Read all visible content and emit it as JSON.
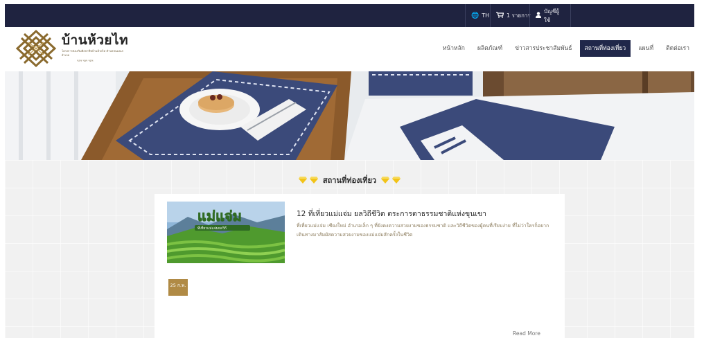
{
  "topbar": {
    "language": "TH",
    "cart": "1 รายการ",
    "account": "บัญชีผู้ใช้"
  },
  "brand": {
    "name": "บ้านห้วยไท",
    "tagline": "โครงการส่งเสริมศิลปาชีพบ้านห้วยไท ตำบลหนองแก อำเภอ",
    "tagline2": "ฯลฯ ฯลฯ ฯลฯ"
  },
  "nav": {
    "items": [
      {
        "label": "หน้าหลัก",
        "active": false
      },
      {
        "label": "ผลิตภัณฑ์",
        "active": false
      },
      {
        "label": "ข่าวสารประชาสัมพันธ์",
        "active": false
      },
      {
        "label": "สถานที่ท่องเที่ยว",
        "active": true
      },
      {
        "label": "แผนที่",
        "active": false
      },
      {
        "label": "ติดต่อเรา",
        "active": false
      }
    ]
  },
  "section": {
    "title": "สถานที่ท่องเที่ยว"
  },
  "post": {
    "title": "12 ที่เที่ยวแม่แจ่ม ยลวิถีชีวิต ตระการตาธรรมชาติแห่งขุนเขา",
    "excerpt": "ที่เที่ยวแม่แจ่ม เชียงใหม่ อำเภอเล็ก ๆ ที่ยังคงความสวยงามของธรรมชาติ และวิถีชีวิตของผู้คนที่เรียบง่าย ที่ไม่ว่าใครก็อยากเดินทางมาสัมผัสความสวยงามของแม่แจ่มสักครั้งในชีวิต",
    "thumb_text": "แม่แจ่ม",
    "thumb_sub": "ที่เที่ยวแม่แจ่มยลวิถี",
    "date": "25 ก.พ.",
    "read_more": "Read More"
  },
  "colors": {
    "navy": "#1f2340",
    "gold": "#b08a45",
    "gem": "#f2c318"
  }
}
